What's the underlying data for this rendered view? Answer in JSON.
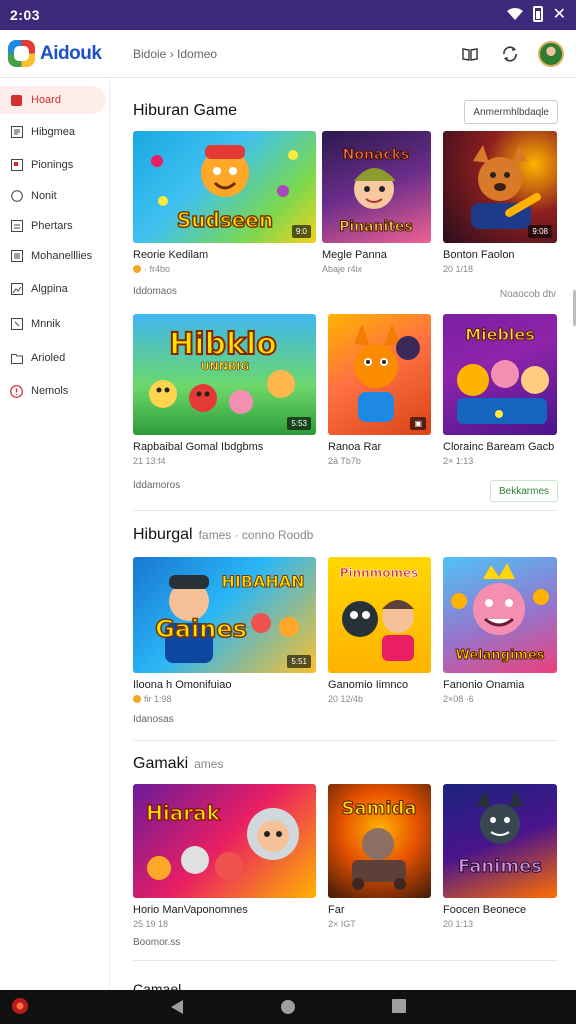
{
  "status_bar": {
    "time": "2:03"
  },
  "app": {
    "name": "Aidouk",
    "breadcrumb": "Bidoie › Idomeo"
  },
  "sidebar": {
    "items": [
      {
        "label": "Hoard",
        "icon": "home-icon",
        "active": true
      },
      {
        "label": "Hibgmea",
        "icon": "grid-icon",
        "active": false
      },
      {
        "label": "Pionings",
        "icon": "bookmark-icon",
        "active": false
      },
      {
        "label": "Nonit",
        "icon": "circle-icon",
        "active": false
      },
      {
        "label": "Phertars",
        "icon": "list-icon",
        "active": false
      },
      {
        "label": "Mohanelllies",
        "icon": "document-icon",
        "active": false
      },
      {
        "label": "Algpina",
        "icon": "image-icon",
        "active": false
      },
      {
        "label": "Mnnik",
        "icon": "square-icon",
        "active": false
      },
      {
        "label": "Arioled",
        "icon": "folder-icon",
        "active": false
      },
      {
        "label": "Nemols",
        "icon": "info-icon",
        "active": false
      }
    ]
  },
  "sections": [
    {
      "title": "Hiburan Game",
      "subtitle": "",
      "action_label": "Anmermhlbdaqle",
      "rows": [
        {
          "cards": [
            {
              "title": "Reorie Kedilam",
              "meta": "· fr4bo",
              "badge": "9:0",
              "art": "Sudseen",
              "rating_dot": true
            },
            {
              "title": "Megle Panna",
              "meta": "Abaje r4ix",
              "badge": "",
              "art": "Pinanites"
            },
            {
              "title": "Bonton Faolon",
              "meta": "20 1/18",
              "badge": "9:08",
              "art": ""
            }
          ],
          "meta": "Iddomaos",
          "link": "Noaocob dtv",
          "button": ""
        },
        {
          "cards": [
            {
              "title": "Rapbaibal Gomal Ibdgbms",
              "meta": "21 13:f4",
              "badge": "5:53",
              "art": "Hibklo"
            },
            {
              "title": "Ranoa Rar",
              "meta": "2ā Tb7b",
              "badge": "",
              "art": ""
            },
            {
              "title": "Clorainc Baream Gacb",
              "meta": "2× 1:13",
              "badge": "",
              "art": "Miebles"
            }
          ],
          "meta": "Iddamoros",
          "link": "",
          "button": "Bekkarmes"
        }
      ]
    },
    {
      "title": "Hiburgal",
      "subtitle": "fames · conno Roodb",
      "action_label": "",
      "rows": [
        {
          "cards": [
            {
              "title": "Iloona h Omonifuiao",
              "meta": "fir 1:98",
              "badge": "5:51",
              "art": "Gaines",
              "rating_dot": true
            },
            {
              "title": "Ganomio Iimnco",
              "meta": "20 12/4b",
              "badge": "",
              "art": "Pinnmomes"
            },
            {
              "title": "Fanonio Onamia",
              "meta": "2×08 ·6",
              "badge": "",
              "art": "Welangimes"
            }
          ],
          "meta": "Idanosas",
          "link": "",
          "button": ""
        }
      ]
    },
    {
      "title": "Gamaki",
      "subtitle": "ames",
      "action_label": "",
      "rows": [
        {
          "cards": [
            {
              "title": "Horio ManVaponomnes",
              "meta": "25 19 18",
              "badge": "",
              "art": "Hiarak"
            },
            {
              "title": "Far",
              "meta": "2× IGT",
              "badge": "",
              "art": "Samida"
            },
            {
              "title": "Foocen Beonece",
              "meta": "20 1:13",
              "badge": "",
              "art": "Fanimes"
            }
          ],
          "meta": "Boomor.ss",
          "link": "",
          "button": ""
        }
      ]
    }
  ],
  "next_section_title": "Camael",
  "colors": {
    "statusbar": "#3b2a7a",
    "accent": "#d32f2f",
    "active_bg": "#fdecea",
    "brand": "#1e50c8"
  }
}
